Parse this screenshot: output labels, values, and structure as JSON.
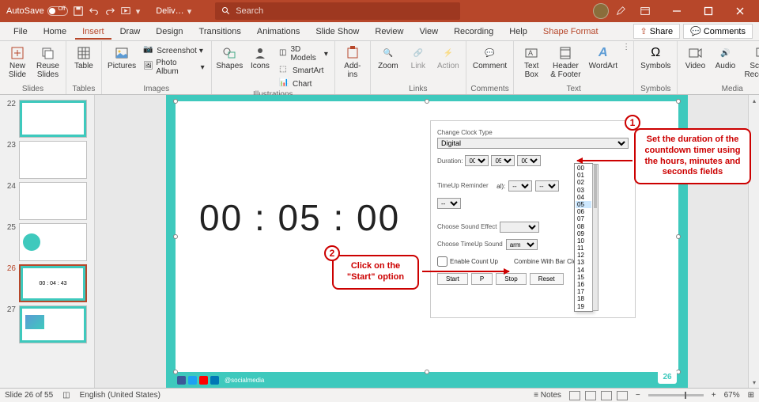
{
  "titlebar": {
    "autosave": "AutoSave",
    "autosave_state": "Off",
    "doc_title": "Deliv…",
    "search_placeholder": "Search"
  },
  "menu": {
    "tabs": [
      "File",
      "Home",
      "Insert",
      "Draw",
      "Design",
      "Transitions",
      "Animations",
      "Slide Show",
      "Review",
      "View",
      "Recording",
      "Help",
      "Shape Format"
    ],
    "active_index": 2,
    "share": "Share",
    "comments": "Comments"
  },
  "ribbon": {
    "slides": {
      "label": "Slides",
      "new_slide": "New\nSlide",
      "reuse_slides": "Reuse\nSlides"
    },
    "tables": {
      "label": "Tables",
      "table": "Table"
    },
    "images": {
      "label": "Images",
      "pictures": "Pictures",
      "screenshot": "Screenshot",
      "photo_album": "Photo Album"
    },
    "illustrations": {
      "label": "Illustrations",
      "shapes": "Shapes",
      "icons": "Icons",
      "threeD": "3D Models",
      "smartart": "SmartArt",
      "chart": "Chart"
    },
    "addins": {
      "label": "",
      "addins": "Add-\nins"
    },
    "links": {
      "label": "Links",
      "zoom": "Zoom",
      "link": "Link",
      "action": "Action"
    },
    "comments": {
      "label": "Comments",
      "comment": "Comment"
    },
    "text": {
      "label": "Text",
      "textbox": "Text\nBox",
      "header": "Header\n& Footer",
      "wordart": "WordArt"
    },
    "symbols": {
      "label": "Symbols",
      "symbols": "Symbols"
    },
    "media": {
      "label": "Media",
      "video": "Video",
      "audio": "Audio",
      "screen_rec": "Screen\nRecording"
    }
  },
  "thumbnails": [
    {
      "num": "22",
      "active": false
    },
    {
      "num": "23",
      "active": false
    },
    {
      "num": "24",
      "active": false
    },
    {
      "num": "25",
      "active": false
    },
    {
      "num": "26",
      "active": true,
      "clock": "00 : 04 : 43"
    },
    {
      "num": "27",
      "active": false
    }
  ],
  "slide": {
    "timer": "00 : 05 : 00",
    "clock_type_label": "Change Clock Type",
    "clock_type_value": "Digital",
    "duration_label": "Duration:",
    "duration_h": "00",
    "duration_m": "05",
    "duration_s": "00",
    "timeup_label": "TimeUp Reminder",
    "sound_label": "Choose Sound Effect",
    "timeup_sound_label": "Choose TimeUp Sound",
    "timeup_sound_value": "arm",
    "countup_label": "Enable Count Up",
    "combine_label": "Combine With Bar Clock",
    "btn_start": "Start",
    "btn_pause": "P",
    "btn_stop": "Stop",
    "btn_reset": "Reset",
    "dropdown_items": [
      "00",
      "01",
      "02",
      "03",
      "04",
      "05",
      "06",
      "07",
      "08",
      "09",
      "10",
      "11",
      "12",
      "13",
      "14",
      "15",
      "16",
      "17",
      "18",
      "19"
    ],
    "social_handle": "@socialmedia",
    "slide_number": "26"
  },
  "callouts": {
    "c1_num": "1",
    "c1_text": "Set the duration of the countdown timer using the hours, minutes and seconds fields",
    "c2_num": "2",
    "c2_text": "Click on the \"Start\" option"
  },
  "statusbar": {
    "slide_info": "Slide 26 of 55",
    "lang": "English (United States)",
    "notes": "Notes",
    "zoom": "67%"
  }
}
